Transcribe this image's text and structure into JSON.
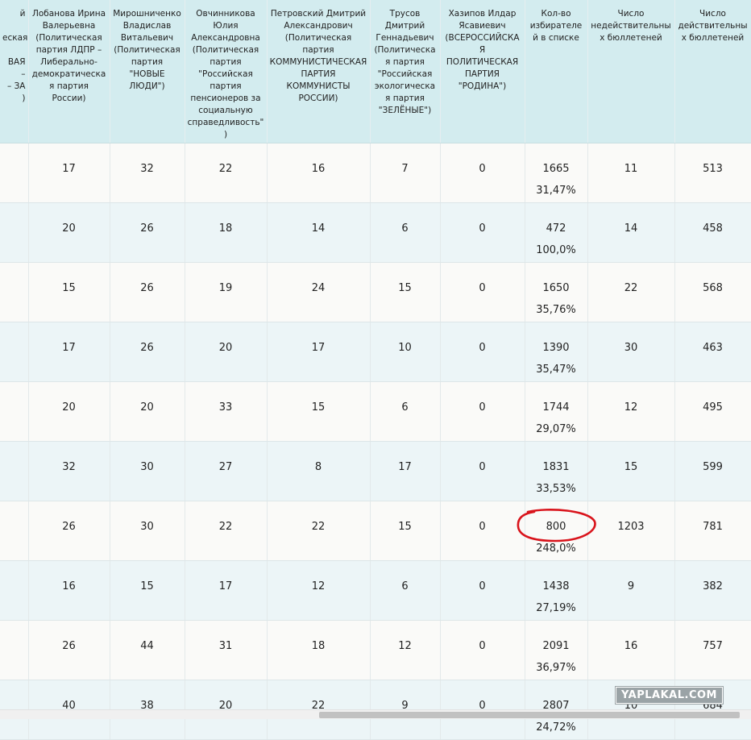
{
  "header": {
    "partial_col": [
      "й",
      "",
      "еская",
      "",
      "ВАЯ",
      "–",
      "– ЗА",
      ")"
    ],
    "columns": [
      "Лобанова Ирина Валерьевна (Политическая партия ЛДПР – Либерально-демократическая партия России)",
      "Мирошниченко Владислав Витальевич (Политическая партия \"НОВЫЕ ЛЮДИ\")",
      "Овчинникова Юлия Александровна (Политическая партия \"Российская партия пенсионеров за социальную справедливость\")",
      "Петровский Дмитрий Александрович (Политическая партия КОММУНИСТИЧЕСКАЯ ПАРТИЯ КОММУНИСТЫ РОССИИ)",
      "Трусов Дмитрий Геннадьевич (Политическая партия \"Российская экологическая партия \"ЗЕЛЁНЫЕ\")",
      "Хазипов Илдар Ясавиевич (ВСЕРОССИЙСКАЯ ПОЛИТИЧЕСКАЯ ПАРТИЯ \"РОДИНА\")",
      "Кол-во избирателей в списке",
      "Число недействительных бюллетеней",
      "Число действительных бюллетеней"
    ]
  },
  "rows": [
    {
      "v": [
        "17",
        "32",
        "22",
        "16",
        "7",
        "0",
        "1665",
        "11",
        "513"
      ],
      "pct": "31,47%"
    },
    {
      "v": [
        "20",
        "26",
        "18",
        "14",
        "6",
        "0",
        "472",
        "14",
        "458"
      ],
      "pct": "100,0%"
    },
    {
      "v": [
        "15",
        "26",
        "19",
        "24",
        "15",
        "0",
        "1650",
        "22",
        "568"
      ],
      "pct": "35,76%"
    },
    {
      "v": [
        "17",
        "26",
        "20",
        "17",
        "10",
        "0",
        "1390",
        "30",
        "463"
      ],
      "pct": "35,47%"
    },
    {
      "v": [
        "20",
        "20",
        "33",
        "15",
        "6",
        "0",
        "1744",
        "12",
        "495"
      ],
      "pct": "29,07%"
    },
    {
      "v": [
        "32",
        "30",
        "27",
        "8",
        "17",
        "0",
        "1831",
        "15",
        "599"
      ],
      "pct": "33,53%"
    },
    {
      "v": [
        "26",
        "30",
        "22",
        "22",
        "15",
        "0",
        "800",
        "1203",
        "781"
      ],
      "pct": "248,0%"
    },
    {
      "v": [
        "16",
        "15",
        "17",
        "12",
        "6",
        "0",
        "1438",
        "9",
        "382"
      ],
      "pct": "27,19%"
    },
    {
      "v": [
        "26",
        "44",
        "31",
        "18",
        "12",
        "0",
        "2091",
        "16",
        "757"
      ],
      "pct": "36,97%"
    },
    {
      "v": [
        "40",
        "38",
        "20",
        "22",
        "9",
        "0",
        "2807",
        "10",
        "684"
      ],
      "pct": "24,72%"
    }
  ],
  "watermark": "YAPLAKAL.COM",
  "colors": {
    "header_bg": "#d3ecef",
    "row_even": "#ecf5f7",
    "row_odd": "#fafaf8",
    "highlight_circle": "#d9141c"
  }
}
